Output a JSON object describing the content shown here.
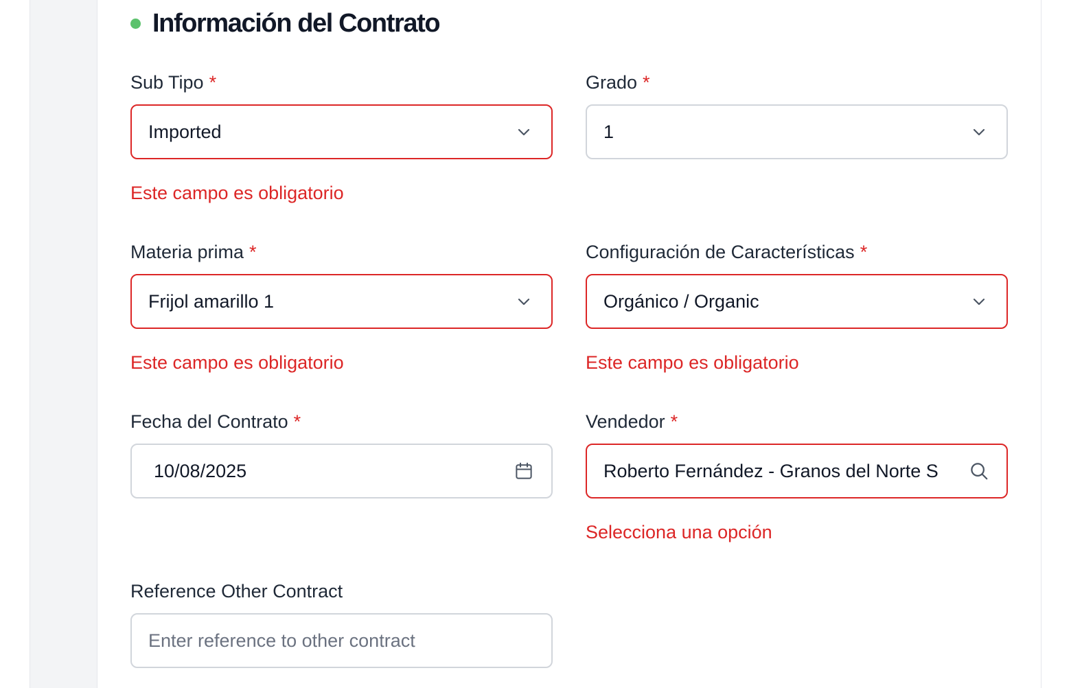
{
  "section": {
    "title": "Información del Contrato"
  },
  "fields": {
    "sub_tipo": {
      "label": "Sub Tipo",
      "required": "*",
      "value": "Imported",
      "error": "Este campo es obligatorio"
    },
    "grado": {
      "label": "Grado",
      "required": "*",
      "value": "1"
    },
    "materia_prima": {
      "label": "Materia prima",
      "required": "*",
      "value": "Frijol amarillo 1",
      "error": "Este campo es obligatorio"
    },
    "configuracion": {
      "label": "Configuración de Características",
      "required": "*",
      "value": "Orgánico / Organic",
      "error": "Este campo es obligatorio"
    },
    "fecha_contrato": {
      "label": "Fecha del Contrato",
      "required": "*",
      "value": "10/08/2025"
    },
    "vendedor": {
      "label": "Vendedor",
      "required": "*",
      "value": "Roberto Fernández - Granos del Norte S",
      "error": "Selecciona una opción"
    },
    "reference_other_contract": {
      "label": "Reference Other Contract",
      "placeholder": "Enter reference to other contract"
    }
  },
  "colors": {
    "status_dot": "#5cc26d",
    "error": "#dc2626",
    "border": "#d1d5db"
  },
  "icons": {
    "dropdown": "chevron-down-icon",
    "date": "calendar-icon",
    "search": "search-icon"
  }
}
